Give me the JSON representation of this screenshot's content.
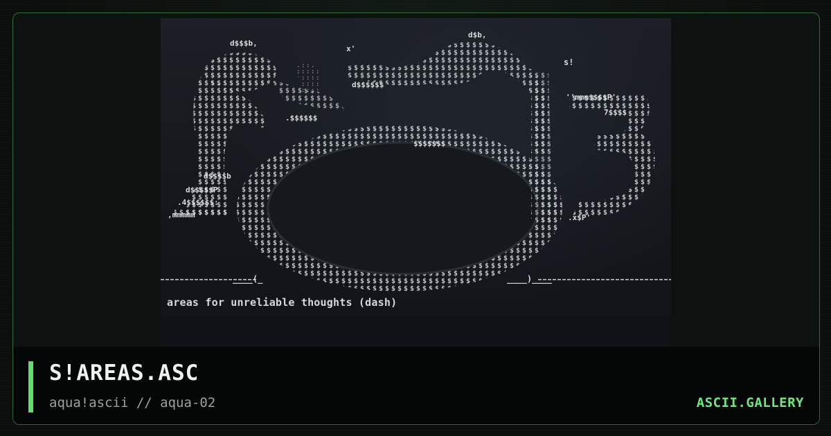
{
  "art": {
    "title": "S!AREAS.ASC",
    "caption": "areas for unreliable thoughts (dash)",
    "fragments": {
      "fragment_1": "d$$$b,",
      "fragment_2": "x'",
      "fragment_3": "d$b,",
      "fragment_4": "s!",
      "fragment_5": "d$$$$$$",
      "fragment_6": ".$$$$$$",
      "fragment_7": "$$$$$$$",
      "fragment_8": "''mmm$$$$P'",
      "fragment_9": "7$$$$",
      "fragment_10": "d$$$$b",
      "fragment_11": "d$$$$$P",
      "fragment_12": ".4$$$$$$:",
      "fragment_13": ",mmmmm",
      "fragment_14": ".x$P'",
      "fragment_15": "____(_",
      "fragment_16": "____)____"
    }
  },
  "footer": {
    "title": "S!AREAS.ASC",
    "subtitle": "aqua!ascii // aqua-02",
    "brand": "ASCII.GALLERY"
  },
  "colors": {
    "accent": "#5ee06f",
    "brand": "#6ee87c",
    "card_border": "#2a6b34",
    "art_bg": "#1c2026"
  },
  "icons": {
    "accent_bar": "vertical-accent-bar"
  }
}
